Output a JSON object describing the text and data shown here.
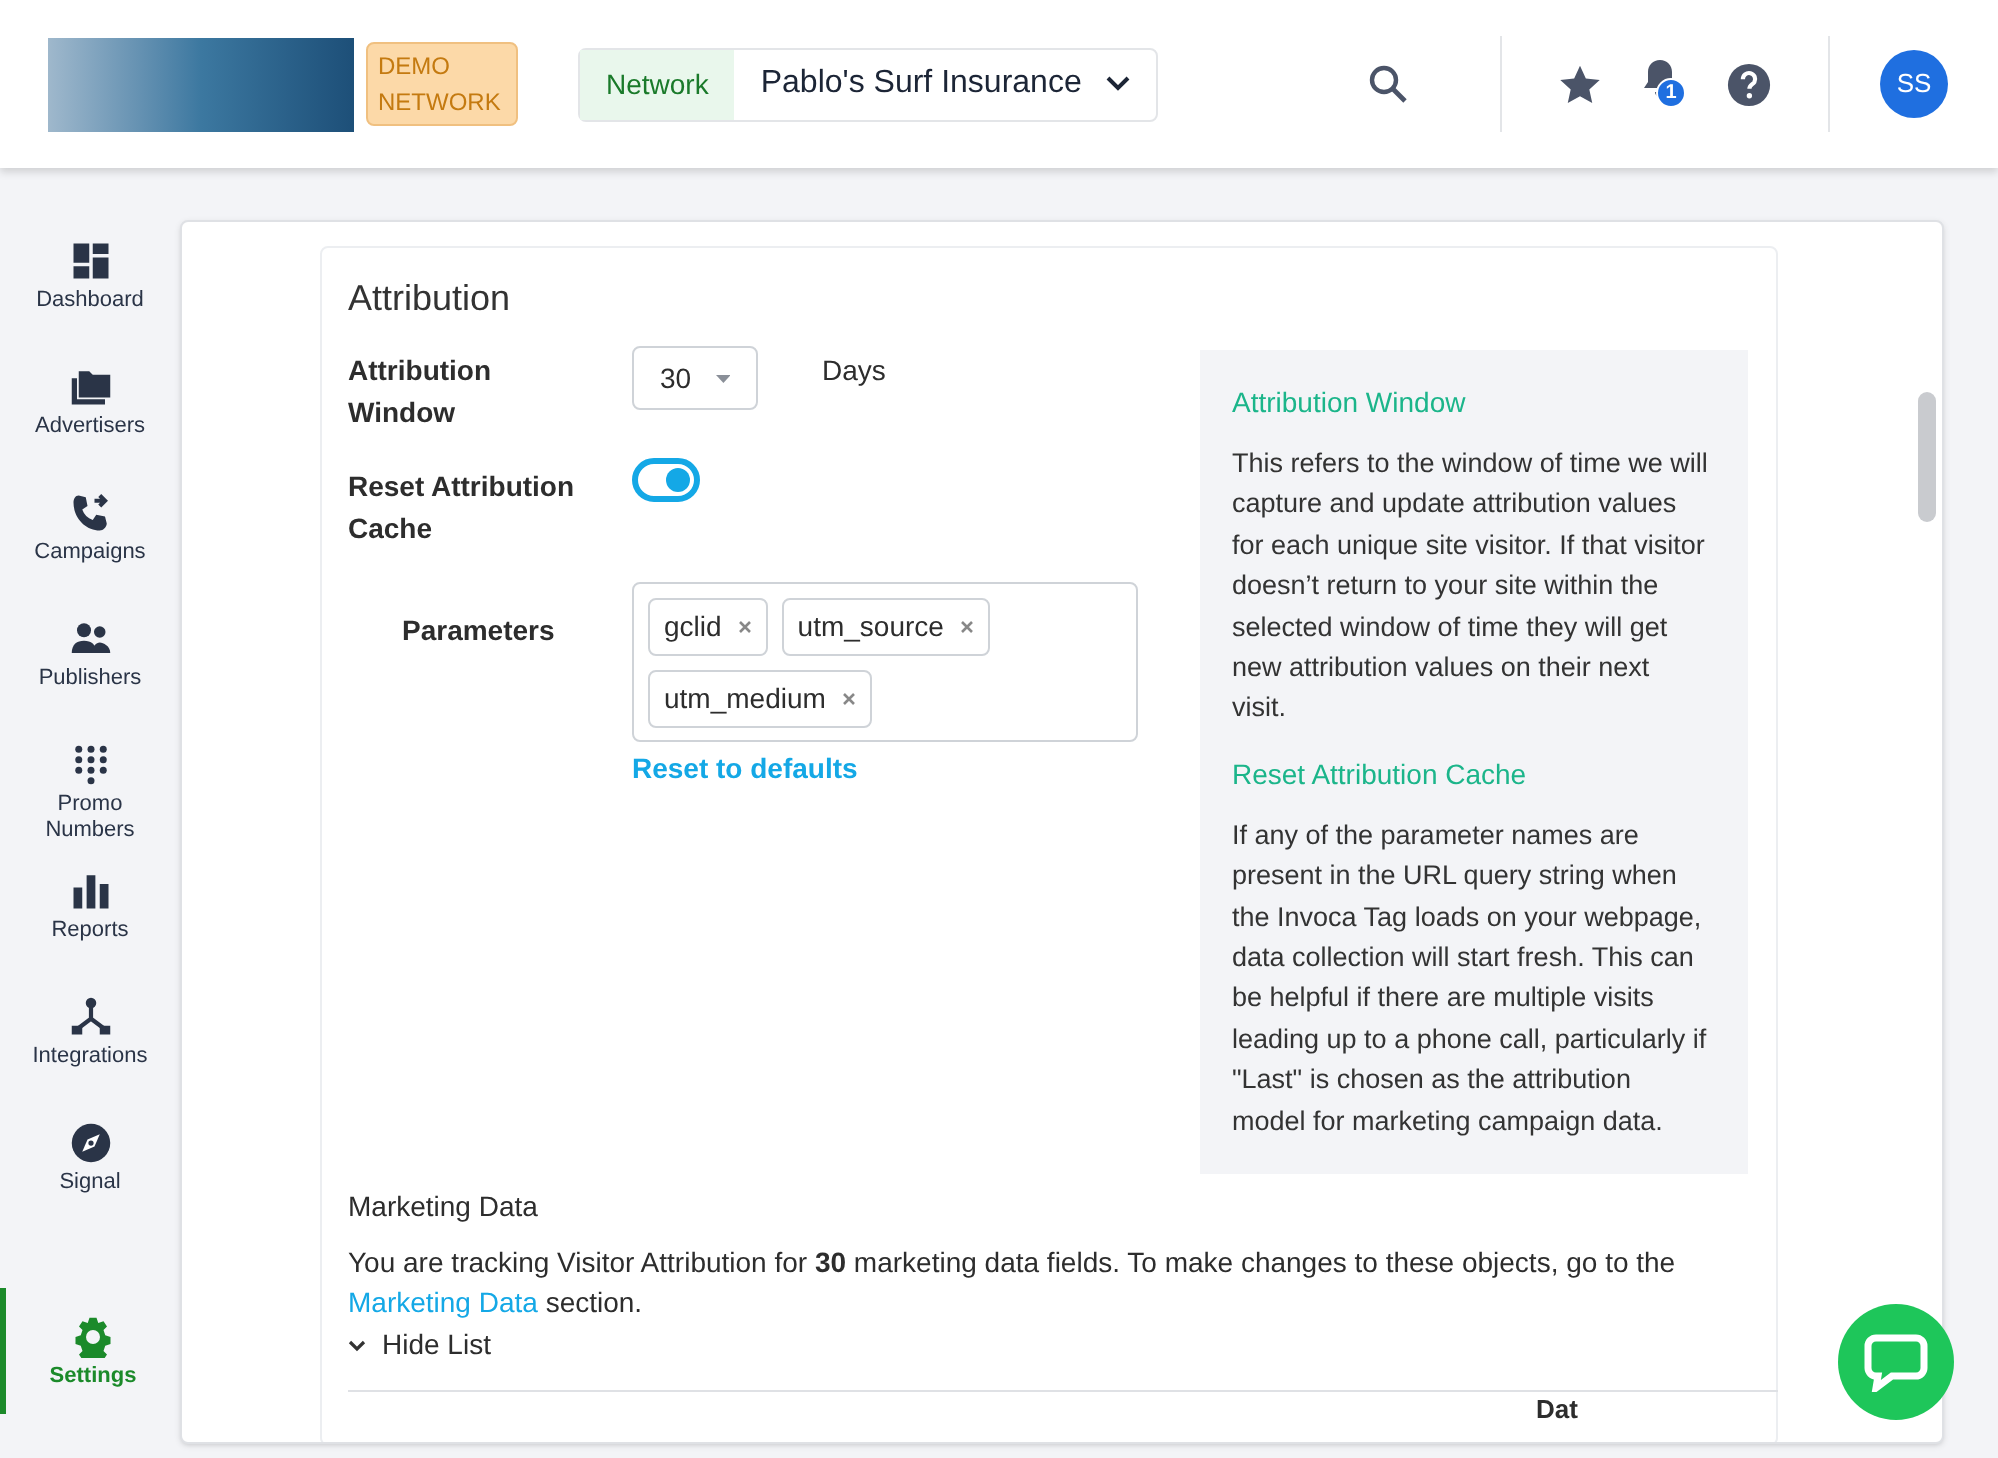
{
  "header": {
    "badge": "DEMO NETWORK",
    "network_label": "Network",
    "network_name": "Pablo's Surf Insurance",
    "notification_count": "1",
    "avatar": "SS"
  },
  "sidebar": {
    "items": [
      {
        "label": "Dashboard",
        "selected": false
      },
      {
        "label": "Advertisers",
        "selected": false
      },
      {
        "label": "Campaigns",
        "selected": false
      },
      {
        "label": "Publishers",
        "selected": false
      },
      {
        "label": "Promo Numbers",
        "selected": false
      },
      {
        "label": "Reports",
        "selected": false
      },
      {
        "label": "Integrations",
        "selected": false
      },
      {
        "label": "Signal",
        "selected": false
      },
      {
        "label": "Settings",
        "selected": true
      }
    ]
  },
  "attribution": {
    "title": "Attribution",
    "window_label": "Attribution Window",
    "window_value": "30",
    "window_unit": "Days",
    "reset_label": "Reset Attribution Cache",
    "reset_on": true,
    "parameters_label": "Parameters",
    "parameters": [
      "gclid",
      "utm_source",
      "utm_medium"
    ],
    "reset_link": "Reset to defaults",
    "help": [
      {
        "title": "Attribution Window",
        "text": "This refers to the window of time we will capture and update attribution values for each unique site visitor. If that visitor doesn’t return to your site within the selected window of time they will get new attribution values on their next visit."
      },
      {
        "title": "Reset Attribution Cache",
        "text": "If any of the parameter names are present in the URL query string when the Invoca Tag loads on your webpage, data collection will start fresh. This can be helpful if there are multiple visits leading up to a phone call, particularly if \"Last\" is chosen as the attribution model for marketing campaign data."
      }
    ]
  },
  "marketing_data": {
    "title": "Marketing Data",
    "text_before": "You are tracking Visitor Attribution for **30** marketing data fields. To make changes to these objects, go to the",
    "link": "Marketing Data",
    "text_after": "section.",
    "toggle": "Hide List",
    "table": {
      "column_1": "Dat"
    }
  }
}
